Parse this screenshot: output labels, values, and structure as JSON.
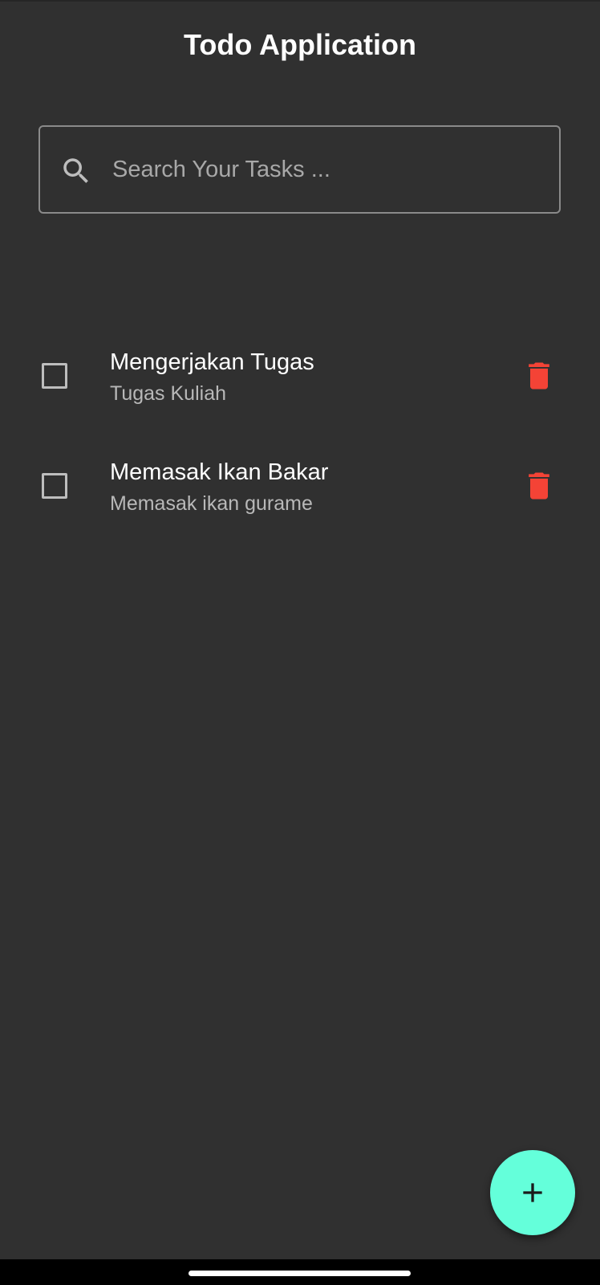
{
  "app": {
    "title": "Todo Application"
  },
  "search": {
    "placeholder": "Search Your Tasks ...",
    "value": "",
    "icon": "search-icon"
  },
  "tasks": [
    {
      "title": "Mengerjakan Tugas",
      "subtitle": "Tugas Kuliah",
      "checked": false,
      "delete_icon": "trash-icon"
    },
    {
      "title": "Memasak Ikan Bakar",
      "subtitle": "Memasak ikan gurame",
      "checked": false,
      "delete_icon": "trash-icon"
    }
  ],
  "fab": {
    "icon": "plus-icon"
  },
  "colors": {
    "background": "#303030",
    "accent": "#64ffda",
    "delete": "#f44336",
    "text_primary": "#ffffff",
    "text_secondary": "#b8b8b8"
  }
}
